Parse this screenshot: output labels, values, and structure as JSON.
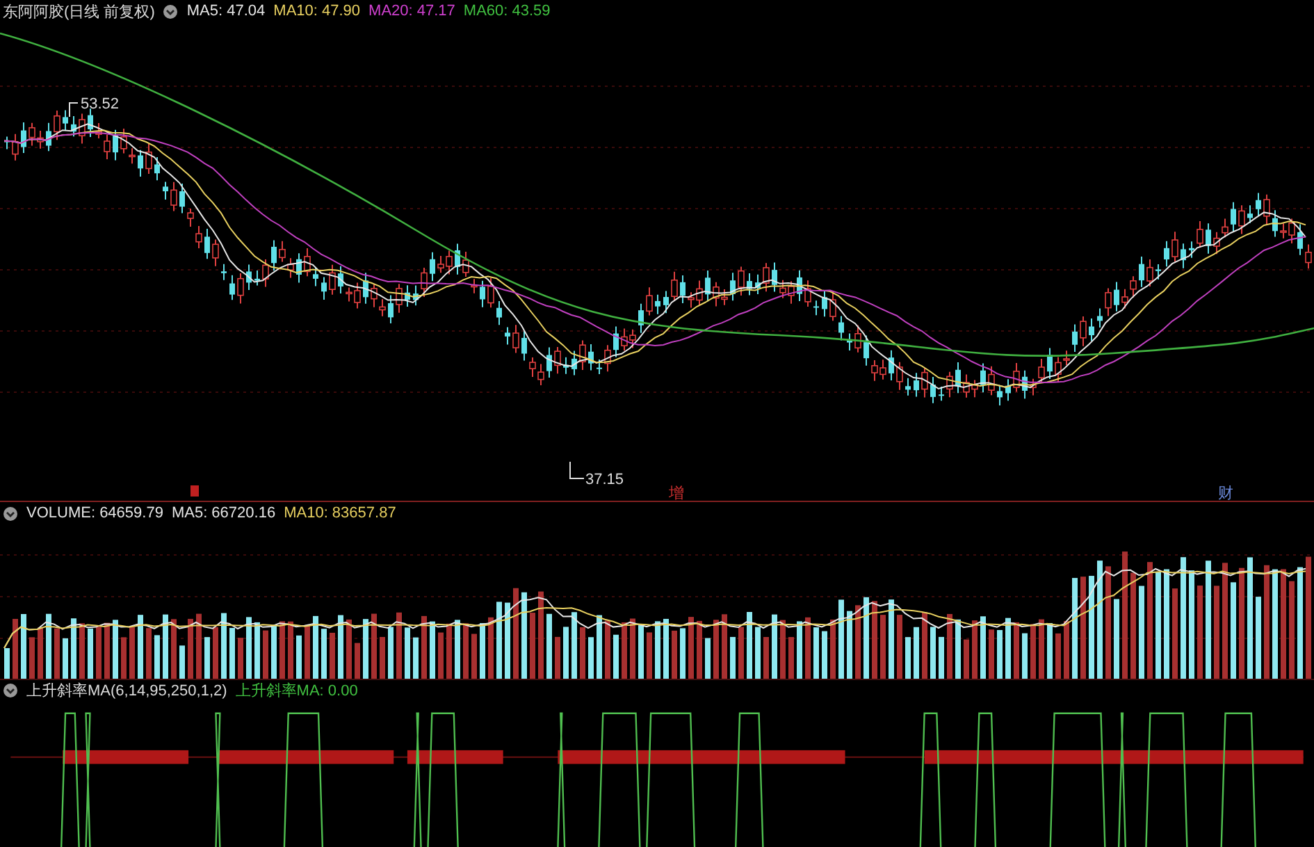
{
  "main_panel": {
    "title": "东阿阿胶(日线 前复权)",
    "indicators": [
      {
        "text": "MA5: 47.04",
        "color": "#e6e6e6"
      },
      {
        "text": "MA10: 47.90",
        "color": "#e8d060"
      },
      {
        "text": "MA20: 47.17",
        "color": "#d040d0"
      },
      {
        "text": "MA60: 43.59",
        "color": "#40c040"
      }
    ],
    "high_label": "53.52",
    "low_label": "37.15",
    "event_marks": [
      {
        "label": "增",
        "color": "#d03030"
      },
      {
        "label": "财",
        "color": "#6a88d8"
      }
    ]
  },
  "volume_panel": {
    "indicators": [
      {
        "text": "VOLUME: 64659.79",
        "color": "#e6e6e6"
      },
      {
        "text": "MA5: 66720.16",
        "color": "#e6e6e6"
      },
      {
        "text": "MA10: 83657.87",
        "color": "#e8d060"
      }
    ]
  },
  "signal_panel": {
    "title": "上升斜率MA(6,14,95,250,1,2)",
    "indicators": [
      {
        "text": "上升斜率MA: 0.00",
        "color": "#40c040"
      }
    ]
  }
}
